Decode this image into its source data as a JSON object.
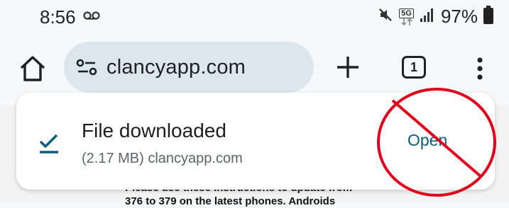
{
  "status_bar": {
    "time": "8:56",
    "network_label": "5G",
    "battery": "97%"
  },
  "toolbar": {
    "url": "clancyapp.com",
    "tab_count": "1"
  },
  "download": {
    "title": "File downloaded",
    "subtitle": "(2.17 MB) clancyapp.com",
    "open_label": "Open"
  },
  "page": {
    "line1": "Please use these instructions to update from",
    "line2": "376 to 379 on the latest phones. Androids"
  },
  "colors": {
    "omnibox": "#dbe6ef",
    "accent": "#0b5d7a",
    "annotation_red": "#e0001b"
  }
}
